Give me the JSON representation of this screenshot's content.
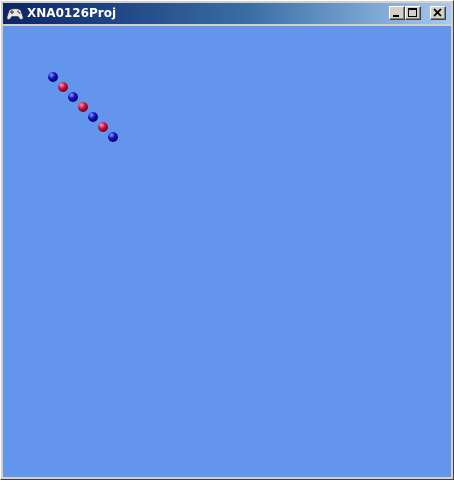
{
  "window": {
    "title": "XNA0126Proj",
    "icon": "gamepad-icon",
    "controls": {
      "minimize_icon": "minimize-icon",
      "maximize_icon": "maximize-icon",
      "close_icon": "close-icon"
    }
  },
  "game": {
    "background_color": "#6495ed",
    "sprites": [
      {
        "color": "blue"
      },
      {
        "color": "red"
      },
      {
        "color": "blue"
      },
      {
        "color": "red"
      },
      {
        "color": "blue"
      },
      {
        "color": "red"
      },
      {
        "color": "blue"
      }
    ]
  },
  "colors": {
    "titlebar_start": "#0a246a",
    "titlebar_end": "#a6caf0",
    "blue_ball": "#1414c8",
    "red_ball": "#d21446"
  }
}
